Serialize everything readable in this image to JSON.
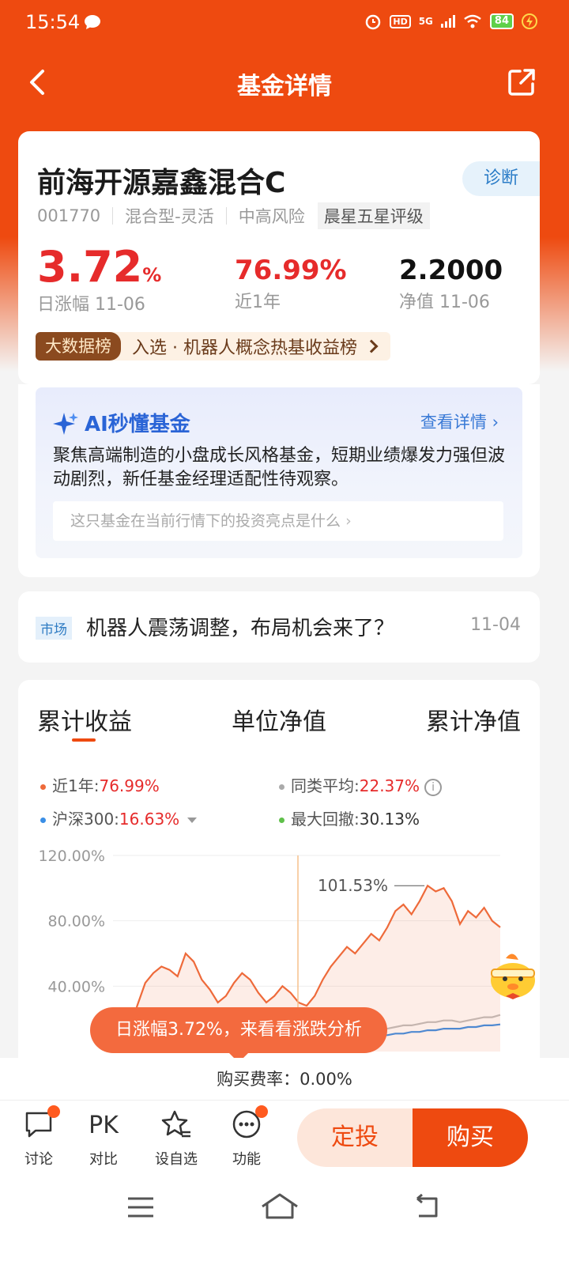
{
  "status": {
    "time": "15:54",
    "battery": "84",
    "network": "5G",
    "hd": "HD"
  },
  "nav": {
    "title": "基金详情"
  },
  "fund": {
    "name": "前海开源嘉鑫混合C",
    "code": "001770",
    "type": "混合型-灵活",
    "risk": "中高风险",
    "rating": "晨星五星评级",
    "diagnose": "诊断",
    "daily_change": "3.72",
    "daily_change_unit": "%",
    "daily_change_label": "日涨幅 11-06",
    "year_return": "76.99%",
    "year_return_label": "近1年",
    "nav": "2.2000",
    "nav_label": "净值 11-06"
  },
  "rank": {
    "badge": "大数据榜",
    "text": "入选 · 机器人概念热基收益榜"
  },
  "ai": {
    "title": "AI秒懂基金",
    "more": "查看详情",
    "body": "聚焦高端制造的小盘成长风格基金，短期业绩爆发力强但波动剧烈，新任基金经理适配性待观察。",
    "question": "这只基金在当前行情下的投资亮点是什么"
  },
  "news": {
    "tag": "市场",
    "title": "机器人震荡调整，布局机会来了？",
    "date": "11-04"
  },
  "chart_tabs": [
    "累计收益",
    "单位净值",
    "累计净值"
  ],
  "legend": {
    "fund_label": "近1年:",
    "fund_value": "76.99%",
    "avg_label": "同类平均:",
    "avg_value": "22.37%",
    "hs300_label": "沪深300:",
    "hs300_value": "16.63%",
    "drawdown_label": "最大回撤:",
    "drawdown_value": "30.13%"
  },
  "chart_data": {
    "type": "line",
    "yticks": [
      "120.00%",
      "80.00%",
      "40.00%"
    ],
    "ylim": [
      0,
      120
    ],
    "peak_label": "101.53%",
    "series": [
      {
        "name": "近1年",
        "color": "#ee6a3a",
        "values": [
          10,
          8,
          12,
          28,
          42,
          48,
          52,
          50,
          46,
          60,
          55,
          44,
          38,
          30,
          34,
          42,
          48,
          44,
          36,
          30,
          34,
          40,
          36,
          30,
          28,
          34,
          44,
          52,
          58,
          64,
          60,
          66,
          72,
          68,
          76,
          86,
          90,
          84,
          92,
          101.5,
          98,
          100,
          92,
          78,
          86,
          82,
          88,
          80,
          76
        ]
      },
      {
        "name": "同类平均",
        "color": "#c0c0c0",
        "values": [
          0,
          0,
          1,
          2,
          3,
          4,
          4,
          5,
          5,
          6,
          5,
          5,
          4,
          4,
          5,
          6,
          6,
          6,
          5,
          5,
          6,
          7,
          7,
          6,
          6,
          7,
          8,
          9,
          10,
          11,
          11,
          12,
          13,
          13,
          14,
          15,
          16,
          16,
          17,
          18,
          18,
          19,
          19,
          18,
          19,
          20,
          21,
          21,
          22.4
        ]
      },
      {
        "name": "沪深300",
        "color": "#3a8ee6",
        "values": [
          0,
          0,
          0,
          1,
          1,
          2,
          2,
          2,
          3,
          3,
          3,
          3,
          3,
          3,
          4,
          4,
          4,
          4,
          4,
          4,
          5,
          5,
          5,
          5,
          5,
          6,
          6,
          7,
          7,
          8,
          8,
          9,
          9,
          10,
          10,
          11,
          11,
          12,
          12,
          13,
          13,
          14,
          14,
          14,
          15,
          15,
          16,
          16,
          16.6
        ]
      }
    ]
  },
  "tip": "日涨幅3.72%，来看看涨跌分析",
  "fee": "购买费率：0.00%",
  "bottom": {
    "discuss": "讨论",
    "pk_icon": "PK",
    "pk": "对比",
    "watch": "设自选",
    "func": "功能",
    "fixed": "定投",
    "buy": "购买"
  },
  "colors": {
    "brand": "#ee4a10",
    "up": "#e62b2b",
    "link": "#2a64d6"
  }
}
